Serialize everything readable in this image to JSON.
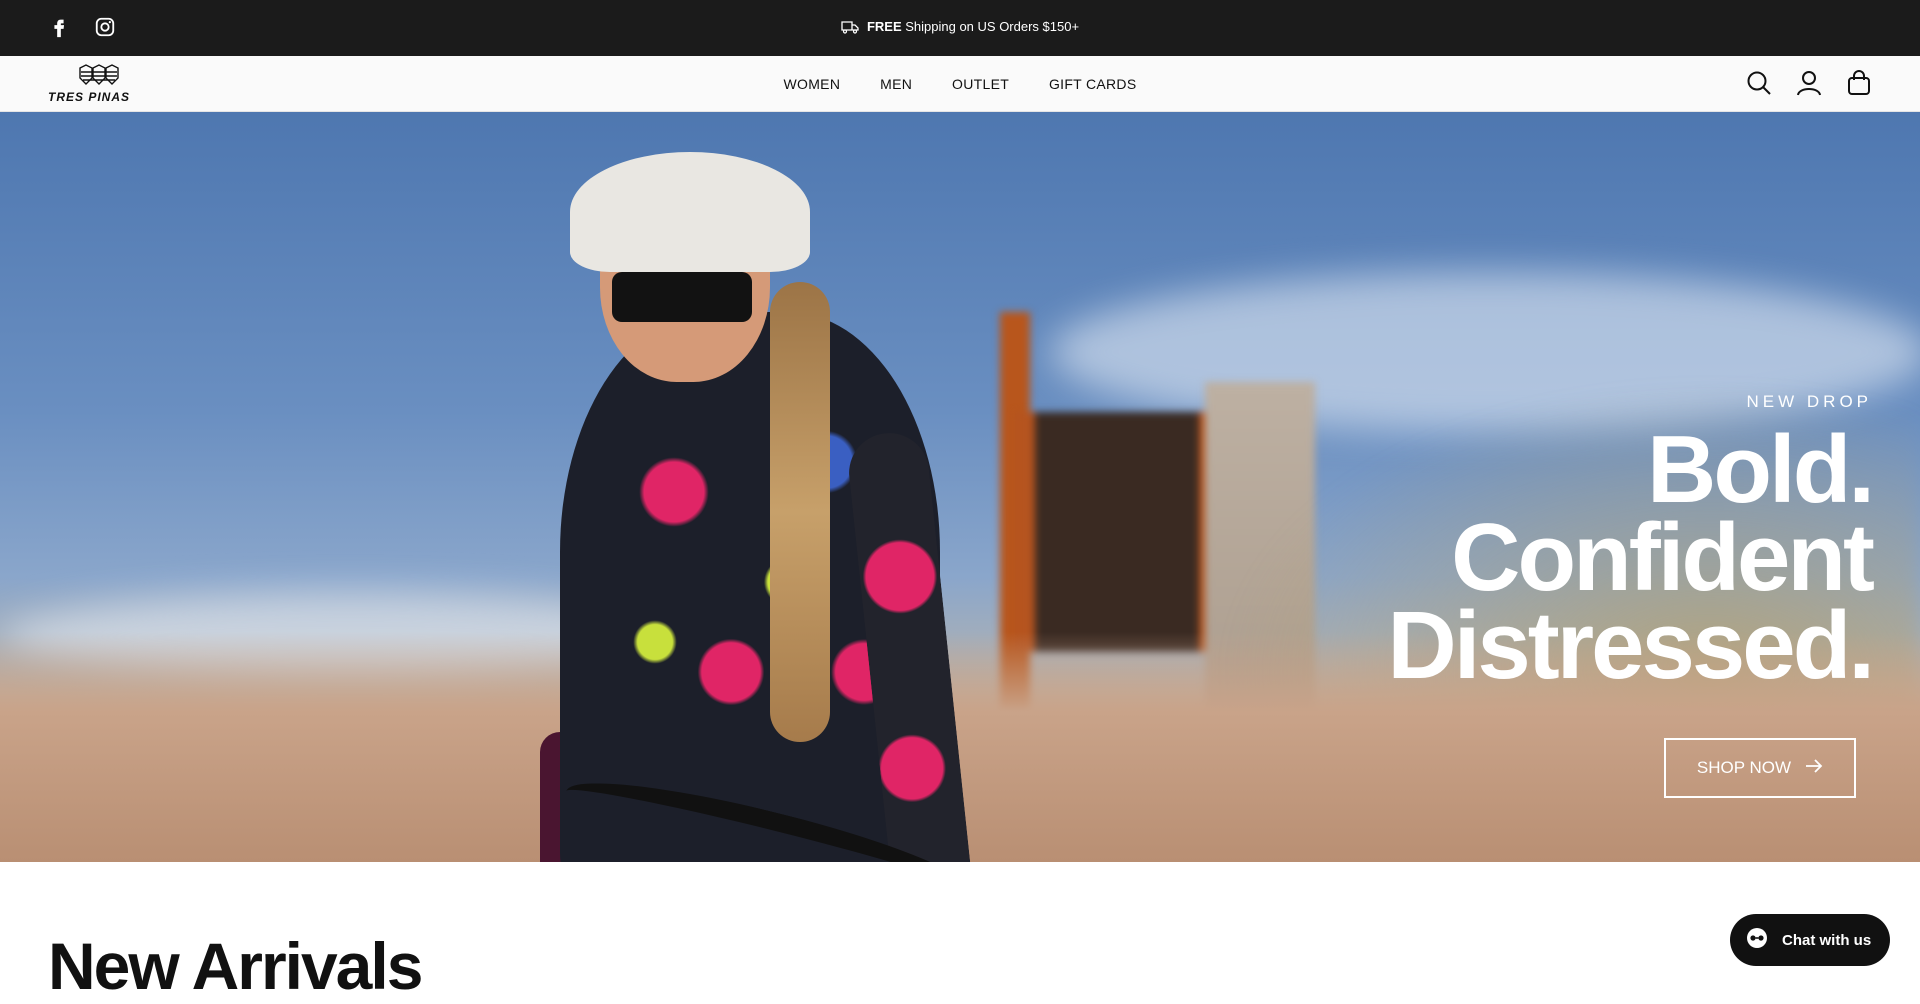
{
  "topbar": {
    "social": [
      {
        "icon": "facebook-icon"
      },
      {
        "icon": "instagram-icon"
      }
    ],
    "announcement": {
      "bold": "FREE",
      "text": " Shipping on US Orders $150+",
      "icon": "truck-icon"
    }
  },
  "header": {
    "logo_text": "TRES PINAS",
    "nav": [
      "WOMEN",
      "MEN",
      "OUTLET",
      "GIFT CARDS"
    ],
    "icons": [
      "search-icon",
      "account-icon",
      "cart-icon"
    ]
  },
  "hero": {
    "eyebrow": "NEW DROP",
    "headline": [
      "Bold.",
      "Confident",
      "Distressed."
    ],
    "button_label": "SHOP NOW"
  },
  "section": {
    "title": "New Arrivals"
  },
  "chat": {
    "label": "Chat with us"
  },
  "colors": {
    "topbar": "#1b1b1b",
    "header": "#fafafa",
    "text": "#111111"
  }
}
